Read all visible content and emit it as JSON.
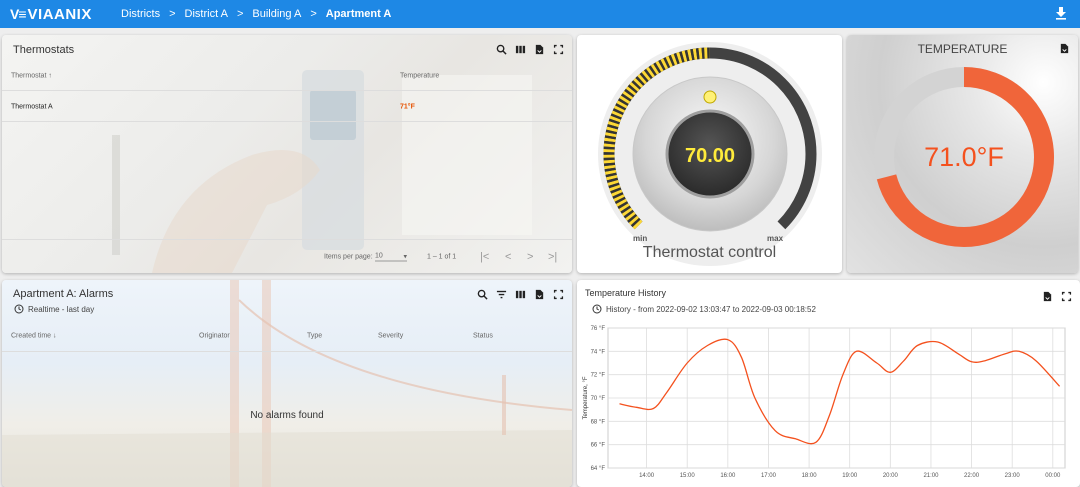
{
  "app": {
    "logo_mark": "V≡",
    "logo_text": "VIAANIX"
  },
  "breadcrumbs": [
    "Districts",
    "District A",
    "Building A",
    "Apartment A"
  ],
  "thermostats": {
    "title": "Thermostats",
    "columns": [
      "Thermostat ↑",
      "Temperature"
    ],
    "rows": [
      {
        "name": "Thermostat A",
        "temperature": "71°F"
      }
    ],
    "paginator": {
      "items_label": "Items per page:",
      "page_size": "10",
      "range": "1 – 1 of 1"
    }
  },
  "thermostat_control": {
    "value": "70.00",
    "title": "Thermostat control",
    "min_label": "min",
    "max_label": "max",
    "level_fraction": 0.5
  },
  "temperature_widget": {
    "title": "TEMPERATURE",
    "value": "71.0°F",
    "fraction": 0.71
  },
  "alarms": {
    "title": "Apartment A: Alarms",
    "subtitle": "Realtime - last day",
    "columns": [
      "Created time ↓",
      "Originator",
      "Type",
      "Severity",
      "Status"
    ],
    "empty_text": "No alarms found"
  },
  "history": {
    "title": "Temperature History",
    "subtitle": "History - from 2022-09-02 13:03:47 to 2022-09-03 00:18:52"
  },
  "chart_data": {
    "type": "line",
    "title": "Temperature History",
    "xlabel": "",
    "ylabel": "Temperature, °F",
    "x_ticks": [
      "14:00",
      "15:00",
      "16:00",
      "17:00",
      "18:00",
      "19:00",
      "20:00",
      "21:00",
      "22:00",
      "23:00",
      "00:00"
    ],
    "y_ticks": [
      "64 °F",
      "66 °F",
      "68 °F",
      "70 °F",
      "72 °F",
      "74 °F",
      "76 °F"
    ],
    "ylim": [
      64,
      76
    ],
    "xlim": [
      "13:03",
      "00:18"
    ],
    "grid": true,
    "series": [
      {
        "color": "#f4511e",
        "x": [
          "13:20",
          "13:45",
          "14:10",
          "14:30",
          "15:00",
          "15:30",
          "16:00",
          "16:20",
          "16:40",
          "17:10",
          "17:40",
          "18:10",
          "18:30",
          "18:50",
          "19:10",
          "19:40",
          "20:00",
          "20:20",
          "20:40",
          "21:10",
          "21:40",
          "22:00",
          "22:20",
          "22:50",
          "23:10",
          "23:35",
          "00:10"
        ],
        "y": [
          69.5,
          69.2,
          69.1,
          70.5,
          73.0,
          74.5,
          75.0,
          73.5,
          70.0,
          67.2,
          66.5,
          66.2,
          68.5,
          72.0,
          74.0,
          73.0,
          72.2,
          73.2,
          74.5,
          74.8,
          73.8,
          73.1,
          73.2,
          73.8,
          74.0,
          73.2,
          71.0
        ]
      }
    ]
  },
  "colors": {
    "primary": "#1e88e5",
    "accent": "#f4511e",
    "gauge_yellow": "#ffeb3b",
    "display_text": "#ffeb3b"
  }
}
